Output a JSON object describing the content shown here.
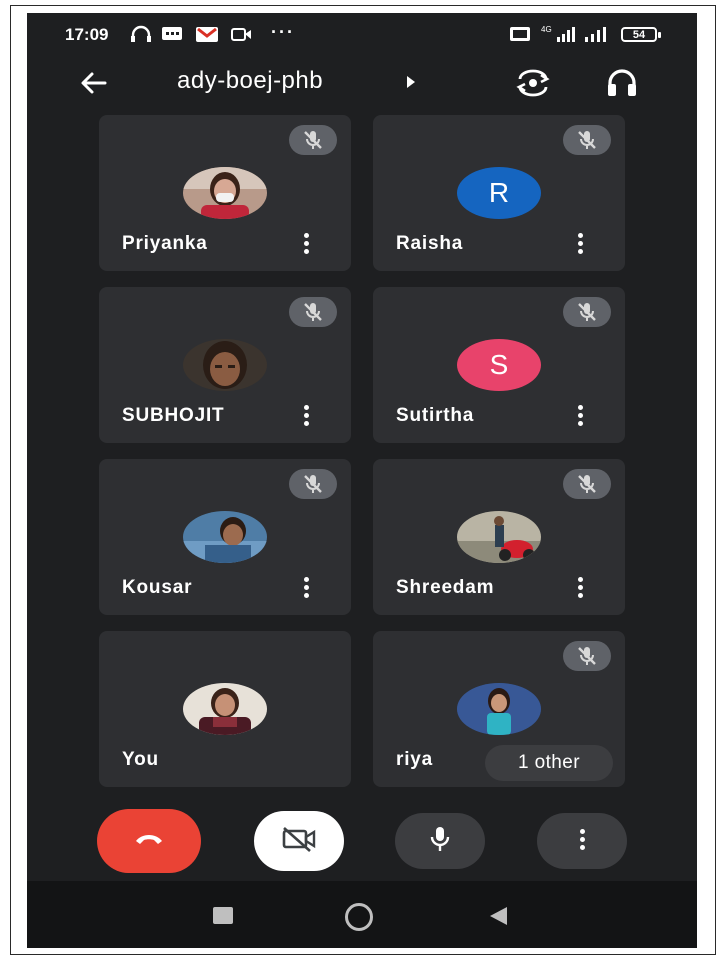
{
  "status_bar": {
    "time": "17:09",
    "battery": "54",
    "icons": [
      "headphones-icon",
      "message-icon",
      "gmail-icon",
      "video-icon",
      "more-dots",
      "volte-icon",
      "signal-4g-icon",
      "signal-icon",
      "battery-icon"
    ]
  },
  "header": {
    "meeting_code": "ady-boej-phb",
    "icons": [
      "back-arrow-icon",
      "caret-right-icon",
      "switch-camera-icon",
      "headphones-icon"
    ]
  },
  "participants": [
    {
      "name": "Priyanka",
      "avatar": "photo",
      "muted": true
    },
    {
      "name": "Raisha",
      "avatar": "R",
      "avatar_color": "#1565c0",
      "muted": true
    },
    {
      "name": "SUBHOJIT",
      "avatar": "photo",
      "muted": true
    },
    {
      "name": "Sutirtha",
      "avatar": "S",
      "avatar_color": "#e8436b",
      "muted": true
    },
    {
      "name": "Kousar",
      "avatar": "photo",
      "muted": true
    },
    {
      "name": "Shreedam",
      "avatar": "photo",
      "muted": true
    },
    {
      "name": "You",
      "avatar": "photo",
      "muted": false
    },
    {
      "name": "riya",
      "avatar": "photo",
      "muted": true,
      "overflow_label": "1 other"
    }
  ],
  "controls": {
    "end_call_color": "#ea4335",
    "icons": [
      "end-call-icon",
      "camera-off-icon",
      "mic-icon",
      "more-vert-icon"
    ]
  },
  "navbar": {
    "icons": [
      "recents-square-icon",
      "home-circle-icon",
      "back-triangle-icon"
    ]
  }
}
